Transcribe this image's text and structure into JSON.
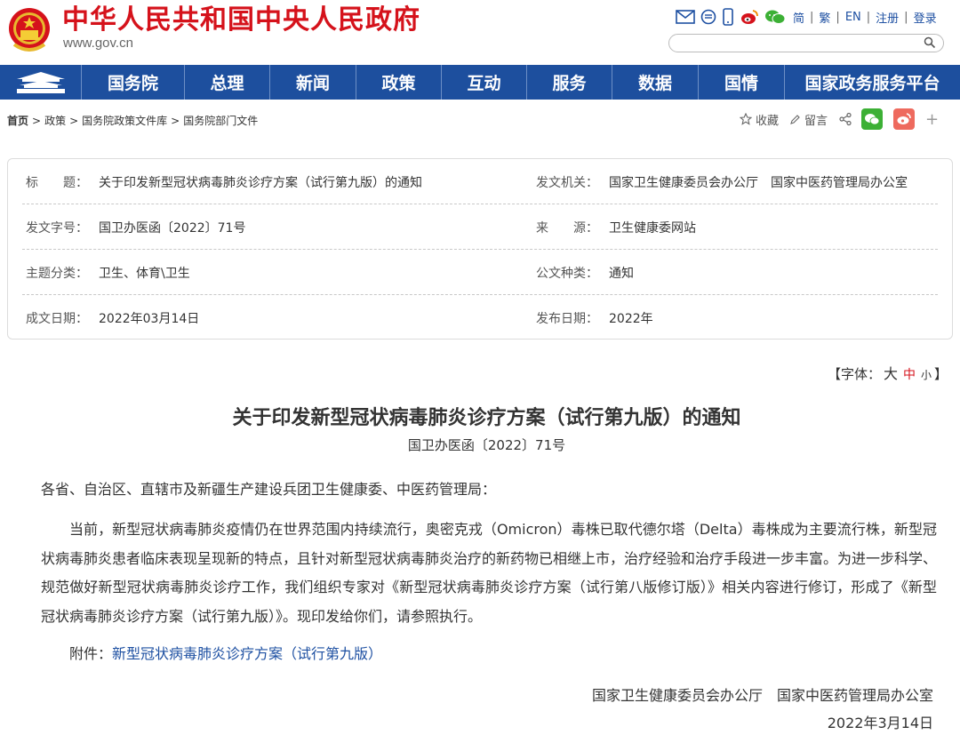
{
  "header": {
    "site_title": "中华人民共和国中央人民政府",
    "site_domain": "www.gov.cn",
    "lang_links": [
      "简",
      "繁",
      "EN",
      "注册",
      "登录"
    ]
  },
  "nav": {
    "items": [
      "国务院",
      "总理",
      "新闻",
      "政策",
      "互动",
      "服务",
      "数据",
      "国情",
      "国家政务服务平台"
    ]
  },
  "breadcrumb": {
    "items": [
      "首页",
      "政策",
      "国务院政策文件库",
      "国务院部门文件"
    ],
    "separator": ">"
  },
  "share": {
    "favorite": "收藏",
    "comment": "留言",
    "plus": "+"
  },
  "meta": {
    "title_label": "标　　题：",
    "title_value": "关于印发新型冠状病毒肺炎诊疗方案（试行第九版）的通知",
    "issuer_label": "发文机关：",
    "issuer_value": "国家卫生健康委员会办公厅　国家中医药管理局办公室",
    "docno_label": "发文字号：",
    "docno_value": "国卫办医函〔2022〕71号",
    "source_label": "来　　源：",
    "source_value": "卫生健康委网站",
    "topic_label": "主题分类：",
    "topic_value": "卫生、体育\\卫生",
    "type_label": "公文种类：",
    "type_value": "通知",
    "written_label": "成文日期：",
    "written_value": "2022年03月14日",
    "published_label": "发布日期：",
    "published_value": "2022年"
  },
  "fontsize": {
    "prefix": "【字体：",
    "big": "大",
    "mid": "中",
    "small": "小",
    "suffix": "】"
  },
  "article": {
    "title": "关于印发新型冠状病毒肺炎诊疗方案（试行第九版）的通知",
    "doc_no": "国卫办医函〔2022〕71号",
    "greeting": "各省、自治区、直辖市及新疆生产建设兵团卫生健康委、中医药管理局：",
    "body": "当前，新型冠状病毒肺炎疫情仍在世界范围内持续流行，奥密克戎（Omicron）毒株已取代德尔塔（Delta）毒株成为主要流行株，新型冠状病毒肺炎患者临床表现呈现新的特点，且针对新型冠状病毒肺炎治疗的新药物已相继上市，治疗经验和治疗手段进一步丰富。为进一步科学、规范做好新型冠状病毒肺炎诊疗工作，我们组织专家对《新型冠状病毒肺炎诊疗方案（试行第八版修订版）》相关内容进行修订，形成了《新型冠状病毒肺炎诊疗方案（试行第九版）》。现印发给你们，请参照执行。",
    "attach_label": "附件：",
    "attach_link": "新型冠状病毒肺炎诊疗方案（试行第九版）",
    "signature": "国家卫生健康委员会办公厅　国家中医药管理局办公室",
    "date": "2022年3月14日"
  },
  "colors": {
    "brand_red": "#d5121b",
    "nav_blue": "#1d4f9e",
    "link_blue": "#1e50a2"
  }
}
